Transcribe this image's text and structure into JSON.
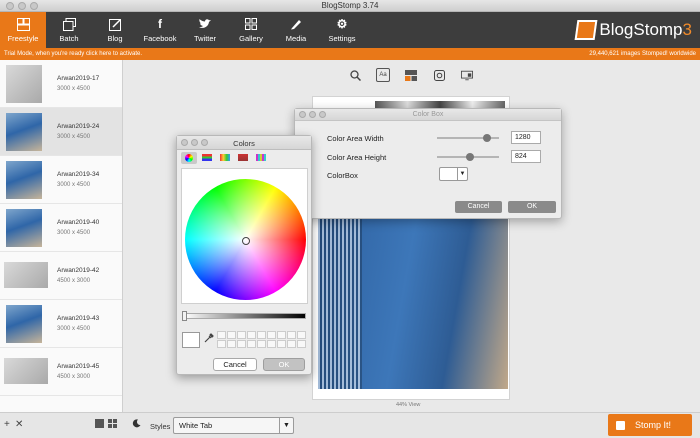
{
  "window": {
    "title": "BlogStomp 3.74"
  },
  "toolbar": {
    "items": [
      {
        "label": "Freestyle",
        "icon": "freestyle-icon"
      },
      {
        "label": "Batch",
        "icon": "batch-icon"
      },
      {
        "label": "Blog",
        "icon": "blog-icon"
      },
      {
        "label": "Facebook",
        "icon": "facebook-icon"
      },
      {
        "label": "Twitter",
        "icon": "twitter-icon"
      },
      {
        "label": "Gallery",
        "icon": "gallery-icon"
      },
      {
        "label": "Media",
        "icon": "media-icon"
      },
      {
        "label": "Settings",
        "icon": "settings-icon"
      }
    ],
    "logo_text": "BlogStomp",
    "logo_num": "3"
  },
  "trial": {
    "message": "Trial Mode, when you're ready click here to activate.",
    "stats": "29,440,621 images Stomped! worldwide"
  },
  "sidebar": {
    "items": [
      {
        "name": "Arwan2019-17",
        "dims": "3000 x 4500"
      },
      {
        "name": "Arwan2019-24",
        "dims": "3000 x 4500"
      },
      {
        "name": "Arwan2019-34",
        "dims": "3000 x 4500"
      },
      {
        "name": "Arwan2019-40",
        "dims": "3000 x 4500"
      },
      {
        "name": "Arwan2019-42",
        "dims": "4500 x 3000"
      },
      {
        "name": "Arwan2019-43",
        "dims": "3000 x 4500"
      },
      {
        "name": "Arwan2019-45",
        "dims": "4500 x 3000"
      }
    ]
  },
  "canvas": {
    "zoom_label": "44% View"
  },
  "colors_panel": {
    "title": "Colors",
    "cancel": "Cancel",
    "ok": "OK"
  },
  "colorbox": {
    "title": "Color Box",
    "width_label": "Color Area Width",
    "width_value": "1280",
    "height_label": "Color Area Height",
    "height_value": "824",
    "colorbox_label": "ColorBox",
    "cancel": "Cancel",
    "ok": "OK"
  },
  "bottom": {
    "styles_label": "Styles",
    "styles_value": "White Tab",
    "stomp_label": "Stomp It!"
  }
}
